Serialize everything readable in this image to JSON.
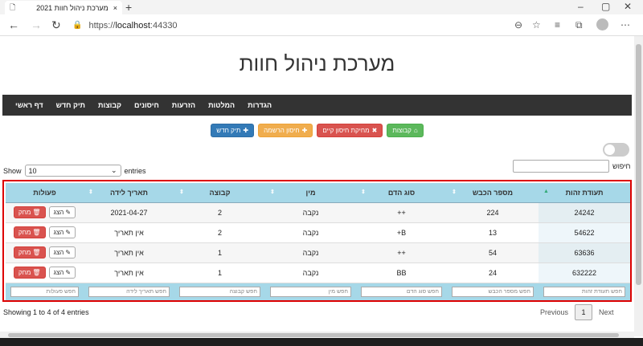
{
  "browser": {
    "tab_title": "2021 מערכת ניהול חוות",
    "tab_close": "×",
    "new_tab": "+",
    "url_scheme": "https://",
    "url_host": "localhost",
    "url_port": ":44330",
    "controls": {
      "minimize": "–",
      "maximize": "▢",
      "close": "✕"
    }
  },
  "page": {
    "title": "מערכת ניהול חוות",
    "nav": [
      "דף ראשי",
      "תיק חדש",
      "קבוצות",
      "חיסונים",
      "הזרעות",
      "המלטות",
      "הגדרות"
    ],
    "actions": [
      {
        "label": "קבוצות",
        "icon": "⌂",
        "color": "green"
      },
      {
        "label": "מחיקת חיסון קיים",
        "icon": "✖",
        "color": "red"
      },
      {
        "label": "חיסון הרשמה",
        "icon": "✚",
        "color": "orange"
      },
      {
        "label": "תיק חדש",
        "icon": "✚",
        "color": "blue"
      }
    ],
    "show_label": "Show",
    "show_value": "10",
    "entries_label": "entries",
    "search_label": "חיפוש"
  },
  "table": {
    "columns": [
      "תעודת זהות",
      "מספר הכבש",
      "סוג הדם",
      "מין",
      "קבוצה",
      "תאריך לידה",
      "פעולות"
    ],
    "rows": [
      [
        "24242",
        "224",
        "++",
        "נקבה",
        "2",
        "2021-04-27"
      ],
      [
        "54622",
        "13",
        "B+",
        "נקבה",
        "2",
        "אין תאריך"
      ],
      [
        "63636",
        "54",
        "++",
        "נקבה",
        "1",
        "אין תאריך"
      ],
      [
        "632222",
        "24",
        "BB",
        "נקבה",
        "1",
        "אין תאריך"
      ]
    ],
    "show_btn": "הצג",
    "delete_btn": "מחק",
    "filters": [
      "חפש תעודת זהות",
      "חפש מספר הכבש",
      "חפש סוג הדם",
      "חפש מין",
      "חפש קבוצה",
      "חפש תאריך לידה",
      "חפש פעולות"
    ]
  },
  "footer": {
    "info": "Showing 1 to 4 of 4 entries",
    "previous": "Previous",
    "current_page": "1",
    "next": "Next"
  }
}
